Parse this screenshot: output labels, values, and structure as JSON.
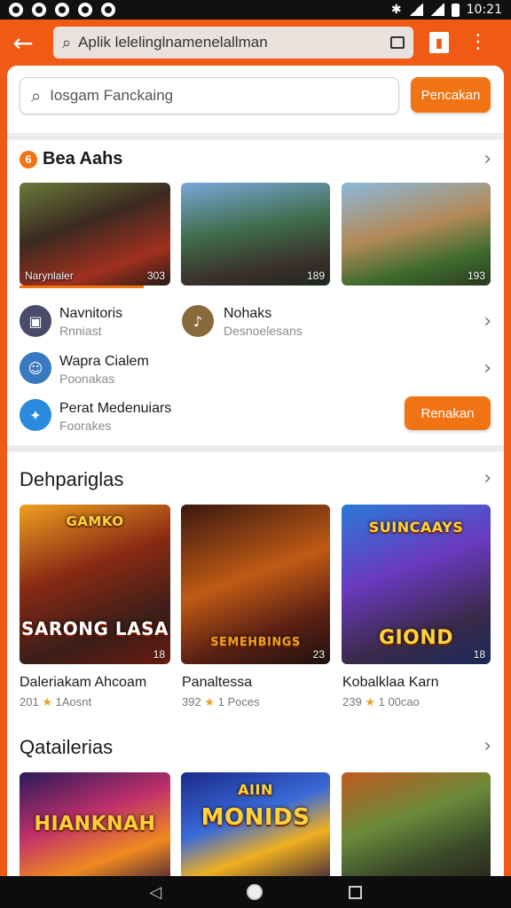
{
  "status_bar": {
    "time": "10:21"
  },
  "app_bar": {
    "url": "Aplik lelelinglnamenelallman",
    "bookmark_icon": "bookmark-icon"
  },
  "search": {
    "placeholder": "Iosgam Fanckaing",
    "button": "Pencakan"
  },
  "section1": {
    "title": "Bea Aahs",
    "thumbs": [
      {
        "caption": "Narynlaler",
        "num": "303"
      },
      {
        "caption": "",
        "num": "189"
      },
      {
        "caption": "",
        "num": "193"
      }
    ],
    "list": [
      {
        "title": "Navnitoris",
        "sub": "Rnniast"
      },
      {
        "title": "Nohaks",
        "sub": "Desnoelesans"
      },
      {
        "title": "Wapra Cialem",
        "sub": "Poonakas"
      },
      {
        "title": "Perat Medenuiars",
        "sub": "Foorakes"
      }
    ],
    "rent_button": "Renakan"
  },
  "section2": {
    "title": "Dehpariglas",
    "games": [
      {
        "art": "SARONG LASA",
        "art_top": "GAMKO",
        "name": "Daleriakam Ahcoam",
        "meta_num": "201",
        "meta_text": "1Aosnt",
        "badge": "18"
      },
      {
        "art": "SEMEHBINGS",
        "art_top": "",
        "name": "Panaltessa",
        "meta_num": "392",
        "meta_text": "1 Poces",
        "badge": "23"
      },
      {
        "art": "GIOND",
        "art_top": "SUINCAAYS",
        "name": "Kobalklaa Karn",
        "meta_num": "239",
        "meta_text": "1 00cao",
        "badge": "18"
      }
    ]
  },
  "section3": {
    "title": "Qatailerias",
    "games": [
      {
        "art": "HIANKNAH"
      },
      {
        "art": "MONIDS",
        "art_top": "AIIN"
      },
      {
        "art": ""
      }
    ]
  }
}
